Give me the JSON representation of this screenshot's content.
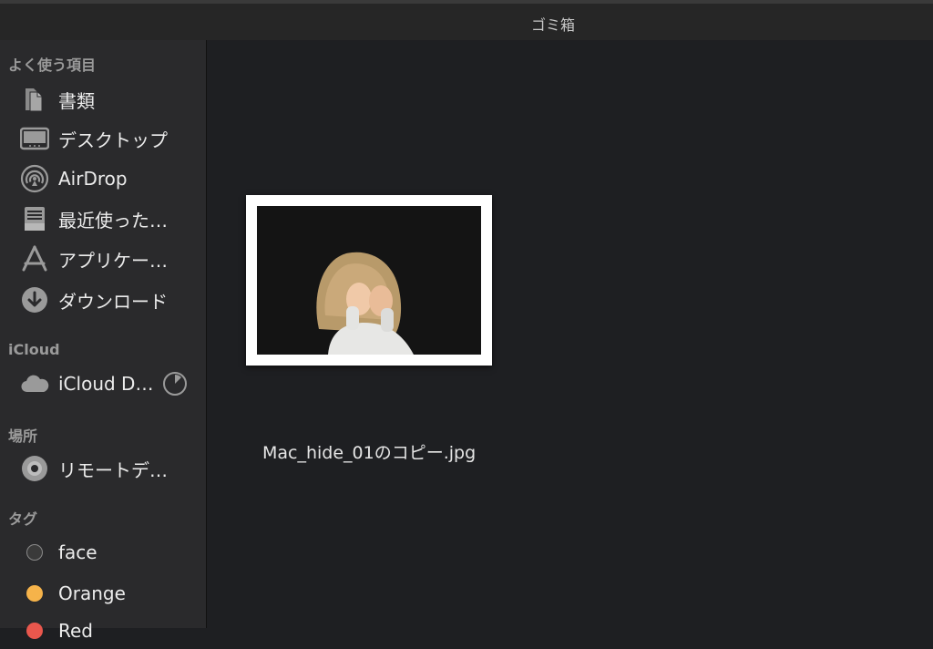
{
  "window": {
    "title": "ゴミ箱"
  },
  "sidebar": {
    "favorites": {
      "title": "よく使う項目",
      "items": [
        {
          "label": "書類",
          "icon": "document-icon"
        },
        {
          "label": "デスクトップ",
          "icon": "desktop-icon"
        },
        {
          "label": "AirDrop",
          "icon": "airdrop-icon"
        },
        {
          "label": "最近使った…",
          "icon": "recents-icon"
        },
        {
          "label": "アプリケー…",
          "icon": "applications-icon"
        },
        {
          "label": "ダウンロード",
          "icon": "download-icon"
        }
      ]
    },
    "icloud": {
      "title": "iCloud",
      "items": [
        {
          "label": "iCloud D…",
          "icon": "cloud-icon"
        }
      ]
    },
    "locations": {
      "title": "場所",
      "items": [
        {
          "label": "リモートデ…",
          "icon": "disc-icon"
        }
      ]
    },
    "tags": {
      "title": "タグ",
      "items": [
        {
          "label": "face",
          "color": "#3a3a3a"
        },
        {
          "label": "Orange",
          "color": "#f6b34a"
        },
        {
          "label": "Red",
          "color": "#e9574d"
        }
      ]
    }
  },
  "main": {
    "files": [
      {
        "name": "Mac_hide_01のコピー.jpg"
      }
    ]
  }
}
